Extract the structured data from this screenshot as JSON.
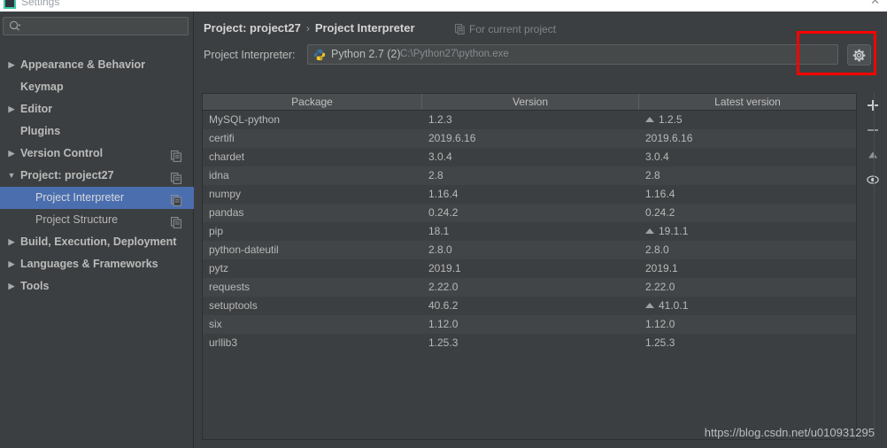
{
  "window": {
    "title": "Settings",
    "close_label": "✕",
    "icon_name": "settings-window-icon"
  },
  "sidebar": {
    "search": {
      "placeholder": "",
      "value": "",
      "icon": "search-icon"
    },
    "items": [
      {
        "label": "Appearance & Behavior",
        "arrow": "▶",
        "expandable": true,
        "child": false,
        "selected": false,
        "copy_icon": false
      },
      {
        "label": "Keymap",
        "arrow": "",
        "expandable": false,
        "child": false,
        "selected": false,
        "copy_icon": false
      },
      {
        "label": "Editor",
        "arrow": "▶",
        "expandable": true,
        "child": false,
        "selected": false,
        "copy_icon": false
      },
      {
        "label": "Plugins",
        "arrow": "",
        "expandable": false,
        "child": false,
        "selected": false,
        "copy_icon": false
      },
      {
        "label": "Version Control",
        "arrow": "▶",
        "expandable": true,
        "child": false,
        "selected": false,
        "copy_icon": true
      },
      {
        "label": "Project: project27",
        "arrow": "▼",
        "expandable": true,
        "child": false,
        "selected": false,
        "copy_icon": true
      },
      {
        "label": "Project Interpreter",
        "arrow": "",
        "expandable": false,
        "child": true,
        "selected": true,
        "copy_icon": true
      },
      {
        "label": "Project Structure",
        "arrow": "",
        "expandable": false,
        "child": true,
        "selected": false,
        "copy_icon": true
      },
      {
        "label": "Build, Execution, Deployment",
        "arrow": "▶",
        "expandable": true,
        "child": false,
        "selected": false,
        "copy_icon": false
      },
      {
        "label": "Languages & Frameworks",
        "arrow": "▶",
        "expandable": true,
        "child": false,
        "selected": false,
        "copy_icon": false
      },
      {
        "label": "Tools",
        "arrow": "▶",
        "expandable": true,
        "child": false,
        "selected": false,
        "copy_icon": false
      }
    ]
  },
  "content": {
    "breadcrumb": {
      "root": "Project: project27",
      "separator": "›",
      "leaf": "Project Interpreter"
    },
    "for_current_project": "For current project",
    "interpreter": {
      "label": "Project Interpreter:",
      "name": "Python 2.7 (2)",
      "path": "C:\\Python27\\python.exe",
      "icon": "python-icon",
      "dropdown_icon": "chevron-down-icon",
      "gear_icon": "gear-icon"
    },
    "table": {
      "headers": [
        "Package",
        "Version",
        "Latest version"
      ],
      "rows": [
        {
          "package": "MySQL-python",
          "version": "1.2.3",
          "latest": "1.2.5",
          "upgradable": true
        },
        {
          "package": "certifi",
          "version": "2019.6.16",
          "latest": "2019.6.16",
          "upgradable": false
        },
        {
          "package": "chardet",
          "version": "3.0.4",
          "latest": "3.0.4",
          "upgradable": false
        },
        {
          "package": "idna",
          "version": "2.8",
          "latest": "2.8",
          "upgradable": false
        },
        {
          "package": "numpy",
          "version": "1.16.4",
          "latest": "1.16.4",
          "upgradable": false
        },
        {
          "package": "pandas",
          "version": "0.24.2",
          "latest": "0.24.2",
          "upgradable": false
        },
        {
          "package": "pip",
          "version": "18.1",
          "latest": "19.1.1",
          "upgradable": true
        },
        {
          "package": "python-dateutil",
          "version": "2.8.0",
          "latest": "2.8.0",
          "upgradable": false
        },
        {
          "package": "pytz",
          "version": "2019.1",
          "latest": "2019.1",
          "upgradable": false
        },
        {
          "package": "requests",
          "version": "2.22.0",
          "latest": "2.22.0",
          "upgradable": false
        },
        {
          "package": "setuptools",
          "version": "40.6.2",
          "latest": "41.0.1",
          "upgradable": true
        },
        {
          "package": "six",
          "version": "1.12.0",
          "latest": "1.12.0",
          "upgradable": false
        },
        {
          "package": "urllib3",
          "version": "1.25.3",
          "latest": "1.25.3",
          "upgradable": false
        }
      ]
    },
    "toolbar": [
      {
        "name": "add-package-button",
        "icon": "plus-icon",
        "label": "+"
      },
      {
        "name": "remove-package-button",
        "icon": "minus-icon",
        "label": "−"
      },
      {
        "name": "upgrade-package-button",
        "icon": "up-arrow-icon",
        "label": "▲"
      },
      {
        "name": "show-early-releases-button",
        "icon": "eye-icon",
        "label": "◉"
      }
    ]
  },
  "watermark": "https://blog.csdn.net/u010931295",
  "colors": {
    "background": "#3c3f41",
    "selection": "#4b6eaf",
    "annotation": "#ff0000",
    "text": "#bbbbbb",
    "header_row": "#4a4d4f"
  }
}
